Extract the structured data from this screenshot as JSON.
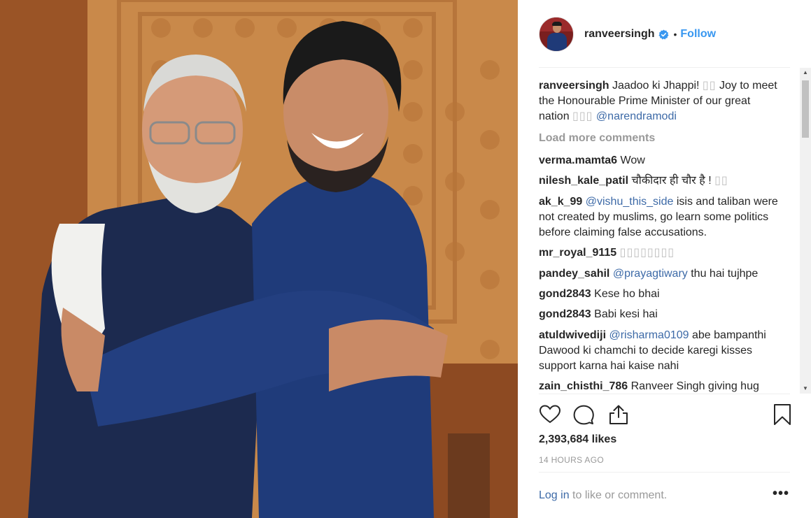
{
  "post": {
    "author": "ranveersingh",
    "follow_label": "Follow",
    "separator_dot": "•",
    "caption": {
      "username": "ranveersingh",
      "text_1": "Jaadoo ki Jhappi!",
      "glyphs_1": "▯▯",
      "text_2": "Joy to meet the Honourable Prime Minister of our great nation",
      "glyphs_2": "▯▯▯",
      "mention": "@narendramodi"
    },
    "load_more_label": "Load more comments",
    "comments": [
      {
        "username": "verma.mamta6",
        "text": "Wow"
      },
      {
        "username": "nilesh_kale_patil",
        "text": "चौकीदार ही चौर है !",
        "glyphs": "▯▯"
      },
      {
        "username": "ak_k_99",
        "mention": "@vishu_this_side",
        "text": "isis and taliban were not created by muslims, go learn some politics before claiming false accusations."
      },
      {
        "username": "mr_royal_9115",
        "glyphs": "▯▯▯▯▯▯▯▯"
      },
      {
        "username": "pandey_sahil",
        "mention": "@prayagtiwary",
        "text": "thu hai tujhpe"
      },
      {
        "username": "gond2843",
        "text": "Kese ho bhai"
      },
      {
        "username": "gond2843",
        "text": "Babi kesi hai"
      },
      {
        "username": "atuldwivediji",
        "mention": "@risharma0109",
        "text": "abe bampanthi Dawood ki chamchi to decide karegi kisses support karna hai kaise nahi"
      },
      {
        "username": "zain_chisthi_786",
        "text": "Ranveer Singh giving hug"
      }
    ],
    "likes": "2,393,684 likes",
    "time_ago": "14 HOURS AGO",
    "login_link": "Log in",
    "login_rest": "to like or comment.",
    "more_label": "•••"
  },
  "icons": {
    "like": "heart-icon",
    "comment": "speech-bubble-icon",
    "share": "share-icon",
    "save": "bookmark-icon",
    "verified": "verified-badge-icon"
  },
  "colors": {
    "link": "#3897f0",
    "mention": "#3d6aa7",
    "muted": "#999999",
    "text": "#262626"
  }
}
